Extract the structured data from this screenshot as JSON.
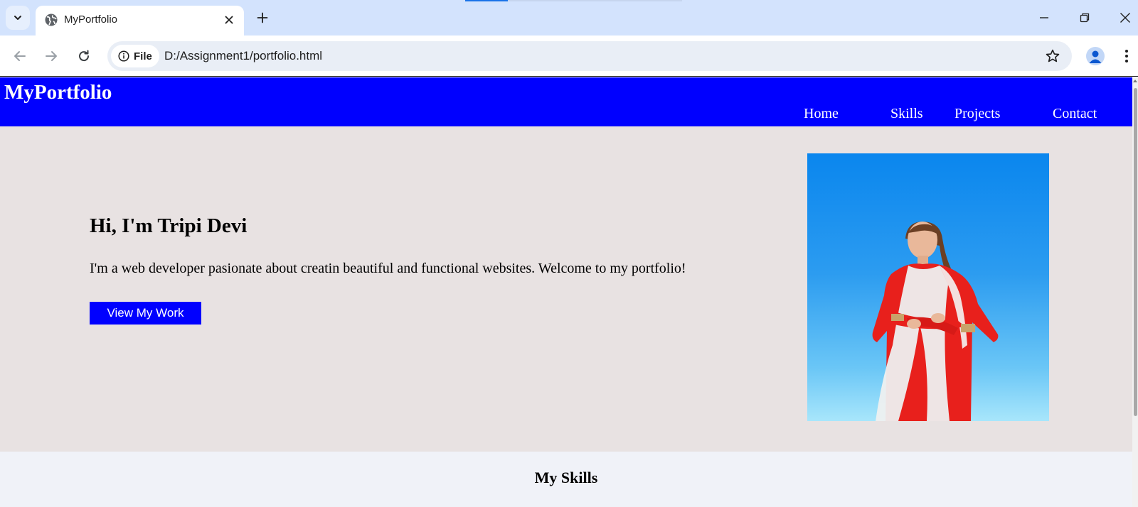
{
  "browser": {
    "tab_title": "MyPortfolio",
    "address_chip": "File",
    "url": "D:/Assignment1/portfolio.html",
    "accent_color": "#1a73e8"
  },
  "site": {
    "logo": "MyPortfolio",
    "nav": [
      "Home",
      "Skills",
      "Projects",
      "Contact"
    ],
    "header_color": "#0000ff"
  },
  "hero": {
    "title": "Hi, I'm Tripi Devi",
    "text": "I'm a web developer pasionate about creatin beautiful and functional websites. Welcome to my portfolio!",
    "button": "View My Work",
    "background": "#e8e2e2"
  },
  "skills": {
    "title": "My Skills"
  },
  "icons": [
    "chevron-down-icon",
    "globe-icon",
    "close-icon",
    "plus-icon",
    "minimize-icon",
    "restore-icon",
    "window-close-icon",
    "back-arrow-icon",
    "forward-arrow-icon",
    "reload-icon",
    "info-icon",
    "star-icon",
    "profile-icon",
    "menu-dots-icon"
  ]
}
